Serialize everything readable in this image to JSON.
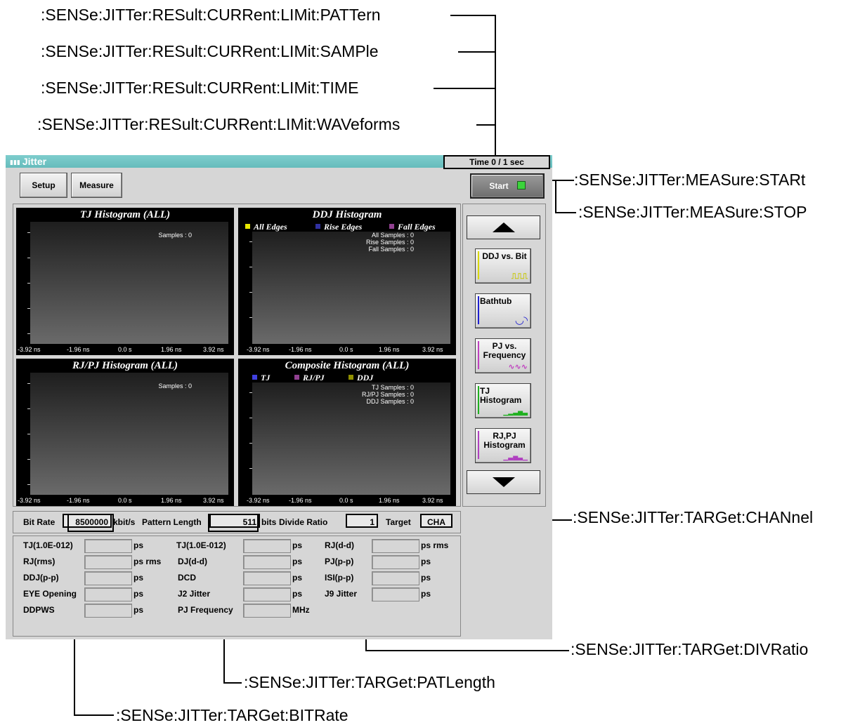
{
  "commands": {
    "limit_pattern": ":SENSe:JITTer:RESult:CURRent:LIMit:PATTern",
    "limit_sample": ":SENSe:JITTer:RESult:CURRent:LIMit:SAMPle",
    "limit_time": ":SENSe:JITTer:RESult:CURRent:LIMit:TIME",
    "limit_waveforms": ":SENSe:JITTer:RESult:CURRent:LIMit:WAVeforms",
    "meas_start": ":SENSe:JITTer:MEASure:STARt",
    "meas_stop": ":SENSe:JITTer:MEASure:STOP",
    "target_channel": ":SENSe:JITTer:TARGet:CHANnel",
    "target_divratio": ":SENSe:JITTer:TARGet:DIVRatio",
    "target_patlength": ":SENSe:JITTer:TARGet:PATLength",
    "target_bitrate": ":SENSe:JITTer:TARGet:BITRate"
  },
  "window": {
    "title": "Jitter",
    "title_icon": "bar-chart-icon",
    "time_status": "Time 0 / 1 sec"
  },
  "toolbar": {
    "setup_label": "Setup",
    "measure_label": "Measure",
    "start_label": "Start",
    "led_color": "#3bd43b"
  },
  "ticks": [
    "-3.92 ns",
    "-1.96 ns",
    "0.0 s",
    "1.96 ns",
    "3.92 ns"
  ],
  "panels": {
    "tj": {
      "title": "TJ Histogram (ALL)",
      "info": [
        "Samples : 0"
      ]
    },
    "ddj": {
      "title": "DDJ Histogram",
      "legend": [
        {
          "label": "All Edges",
          "color": "#e8e800"
        },
        {
          "label": "Rise Edges",
          "color": "#3030a0"
        },
        {
          "label": "Fall Edges",
          "color": "#904090"
        }
      ],
      "info": [
        "All Samples : 0",
        "Rise Samples : 0",
        "Fall Samples : 0"
      ]
    },
    "rjpj": {
      "title": "RJ/PJ Histogram (ALL)",
      "info": [
        "Samples : 0"
      ]
    },
    "composite": {
      "title": "Composite Histogram (ALL)",
      "legend": [
        {
          "label": "TJ",
          "color": "#4040e0"
        },
        {
          "label": "RJ/PJ",
          "color": "#904090"
        },
        {
          "label": "DDJ",
          "color": "#909000"
        }
      ],
      "info": [
        "TJ Samples : 0",
        "RJ/PJ Samples : 0",
        "DDJ Samples : 0"
      ]
    }
  },
  "view_buttons": [
    {
      "label": "DDJ vs. Bit",
      "accent": "#d8d800",
      "glyph": "⎍⎍⎍"
    },
    {
      "label": "Bathtub",
      "accent": "#2020d0",
      "glyph": "◡◝"
    },
    {
      "label": "PJ vs. Frequency",
      "accent": "#c040c0",
      "glyph": "∿∿∿"
    },
    {
      "label": "TJ Histogram",
      "accent": "#20b020",
      "glyph": "▁▂▃▅▃"
    },
    {
      "label": "RJ,PJ Histogram",
      "accent": "#b040c0",
      "glyph": "▁▃▅▃▁"
    }
  ],
  "target": {
    "bitrate_label": "Bit Rate",
    "bitrate_value": "8500000",
    "bitrate_unit": "kbit/s",
    "patlen_label": "Pattern Length",
    "patlen_value": "511",
    "patlen_unit": "bits",
    "divide_label": "Divide Ratio",
    "divide_value": "1",
    "target_label": "Target",
    "target_value": "CHA"
  },
  "results": {
    "col1": [
      {
        "label": "TJ(1.0E-012)",
        "unit": "ps"
      },
      {
        "label": "RJ(rms)",
        "unit": "ps rms"
      },
      {
        "label": "DDJ(p-p)",
        "unit": "ps"
      },
      {
        "label": "EYE Opening",
        "unit": "ps"
      },
      {
        "label": "DDPWS",
        "unit": "ps"
      }
    ],
    "col2": [
      {
        "label": "TJ(1.0E-012)",
        "unit": "ps"
      },
      {
        "label": "DJ(d-d)",
        "unit": "ps"
      },
      {
        "label": "DCD",
        "unit": "ps"
      },
      {
        "label": "J2 Jitter",
        "unit": "ps"
      },
      {
        "label": "PJ Frequency",
        "unit": "MHz"
      }
    ],
    "col3": [
      {
        "label": "RJ(d-d)",
        "unit": "ps rms"
      },
      {
        "label": "PJ(p-p)",
        "unit": "ps"
      },
      {
        "label": "ISI(p-p)",
        "unit": "ps"
      },
      {
        "label": "J9 Jitter",
        "unit": "ps"
      }
    ]
  }
}
